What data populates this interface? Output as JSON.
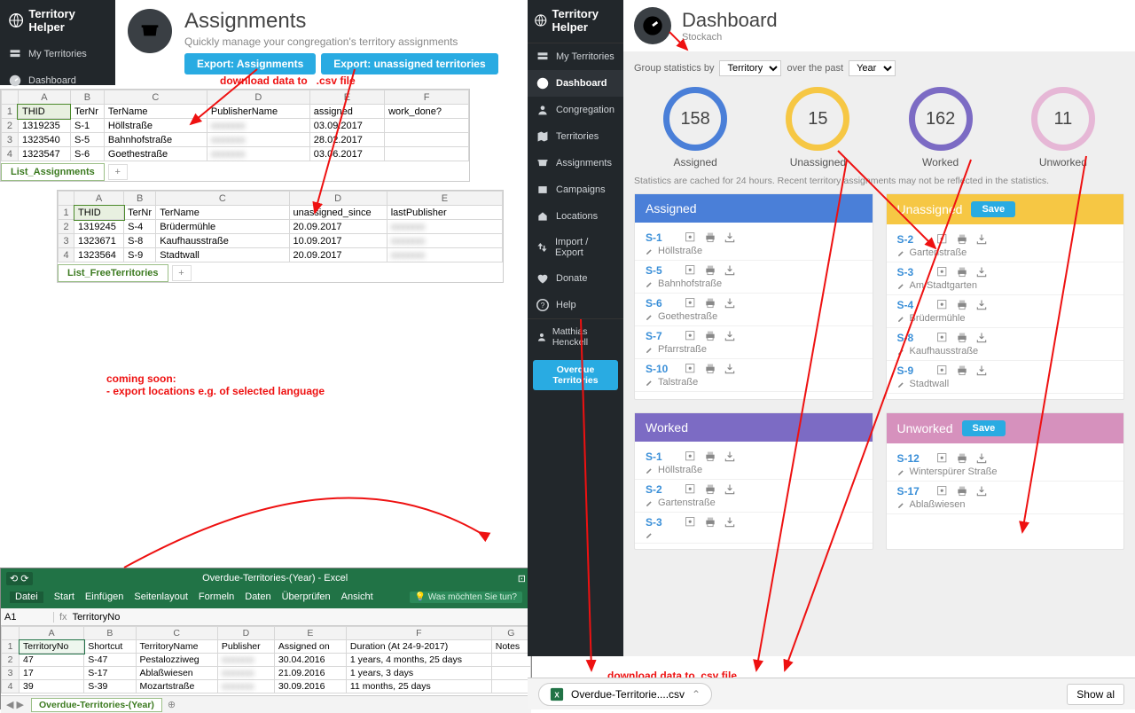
{
  "left": {
    "brand": "Territory Helper",
    "nav": {
      "myTerritories": "My Territories",
      "dashboard": "Dashboard"
    },
    "title": "Assignments",
    "subtitle": "Quickly manage your congregation's territory assignments",
    "exportAssign": "Export: Assignments",
    "exportUnassigned": "Export: unassigned territories",
    "noteDownload": "download data to   .csv file",
    "comingSoon1": "coming soon:",
    "comingSoon2": "- export locations e.g. of selected language"
  },
  "sheet1": {
    "cols": [
      "A",
      "B",
      "C",
      "D",
      "E",
      "F"
    ],
    "headers": [
      "THID",
      "TerNr",
      "TerName",
      "PublisherName",
      "assigned",
      "work_done?"
    ],
    "rows": [
      [
        "1319235",
        "S-1",
        "Höllstraße",
        "",
        "03.09.2017",
        ""
      ],
      [
        "1323540",
        "S-5",
        "Bahnhofstraße",
        "",
        "28.02.2017",
        ""
      ],
      [
        "1323547",
        "S-6",
        "Goethestraße",
        "",
        "03.06.2017",
        ""
      ]
    ],
    "tab": "List_Assignments"
  },
  "sheet2": {
    "cols": [
      "A",
      "B",
      "C",
      "D",
      "E"
    ],
    "headers": [
      "THID",
      "TerNr",
      "TerName",
      "unassigned_since",
      "lastPublisher"
    ],
    "rows": [
      [
        "1319245",
        "S-4",
        "Brüdermühle",
        "20.09.2017",
        ""
      ],
      [
        "1323671",
        "S-8",
        "Kaufhausstraße",
        "10.09.2017",
        ""
      ],
      [
        "1323564",
        "S-9",
        "Stadtwall",
        "20.09.2017",
        ""
      ]
    ],
    "tab": "List_FreeTerritories"
  },
  "excel": {
    "title": "Overdue-Territories-(Year) - Excel",
    "ribbonTabs": [
      "Datei",
      "Start",
      "Einfügen",
      "Seitenlayout",
      "Formeln",
      "Daten",
      "Überprüfen",
      "Ansicht"
    ],
    "tellme": "Was möchten Sie tun?",
    "namebox": "A1",
    "fxval": "TerritoryNo",
    "cols": [
      "A",
      "B",
      "C",
      "D",
      "E",
      "F",
      "G"
    ],
    "headers": [
      "TerritoryNo",
      "Shortcut",
      "TerritoryName",
      "Publisher",
      "Assigned on",
      "Duration (At 24-9-2017)",
      "Notes"
    ],
    "rows": [
      [
        "47",
        "S-47",
        "Pestalozziweg",
        "",
        "30.04.2016",
        "1 years, 4 months, 25 days",
        ""
      ],
      [
        "17",
        "S-17",
        "Ablaßwiesen",
        "",
        "21.09.2016",
        "1 years, 3 days",
        ""
      ],
      [
        "39",
        "S-39",
        "Mozartstraße",
        "",
        "30.09.2016",
        "11 months, 25 days",
        ""
      ]
    ],
    "tab": "Overdue-Territories-(Year)"
  },
  "right": {
    "brand": "Territory Helper",
    "overdueBtn": "Overdue Territories",
    "userName": "Matthias Henckell",
    "nav": {
      "myTerritories": "My Territories",
      "dashboard": "Dashboard",
      "congregation": "Congregation",
      "territories": "Territories",
      "assignments": "Assignments",
      "campaigns": "Campaigns",
      "locations": "Locations",
      "importExport": "Import / Export",
      "donate": "Donate",
      "help": "Help"
    },
    "dash": {
      "title": "Dashboard",
      "sub": "Stockach",
      "filterPre": "Group statistics by",
      "filterSel1": "Territory",
      "filterMid": "over the past",
      "filterSel2": "Year",
      "rings": {
        "assigned": "158",
        "unassigned": "15",
        "worked": "162",
        "unworked": "11"
      },
      "ringLabels": {
        "assigned": "Assigned",
        "unassigned": "Unassigned",
        "worked": "Worked",
        "unworked": "Unworked"
      },
      "cacheNote": "Statistics are cached for 24 hours. Recent territory assignments may not be reflected in the statistics.",
      "saveBtn": "Save",
      "cardTitles": {
        "assigned": "Assigned",
        "unassigned": "Unassigned",
        "worked": "Worked",
        "unworked": "Unworked"
      },
      "assigned": [
        {
          "id": "S-1",
          "loc": "Höllstraße"
        },
        {
          "id": "S-5",
          "loc": "Bahnhofstraße"
        },
        {
          "id": "S-6",
          "loc": "Goethestraße"
        },
        {
          "id": "S-7",
          "loc": "Pfarrstraße"
        },
        {
          "id": "S-10",
          "loc": "Talstraße"
        }
      ],
      "unassigned": [
        {
          "id": "S-2",
          "loc": "Gartenstraße"
        },
        {
          "id": "S-3",
          "loc": "Am Stadtgarten"
        },
        {
          "id": "S-4",
          "loc": "Brüdermühle"
        },
        {
          "id": "S-8",
          "loc": "Kaufhausstraße"
        },
        {
          "id": "S-9",
          "loc": "Stadtwall"
        }
      ],
      "worked": [
        {
          "id": "S-1",
          "loc": "Höllstraße"
        },
        {
          "id": "S-2",
          "loc": "Gartenstraße"
        },
        {
          "id": "S-3",
          "loc": ""
        }
      ],
      "unworked": [
        {
          "id": "S-12",
          "loc": "Winterspürer Straße"
        },
        {
          "id": "S-17",
          "loc": "Ablaßwiesen"
        }
      ]
    },
    "downloadNote": "download data to .csv file",
    "dlFile": "Overdue-Territorie....csv",
    "showAll": "Show al"
  }
}
